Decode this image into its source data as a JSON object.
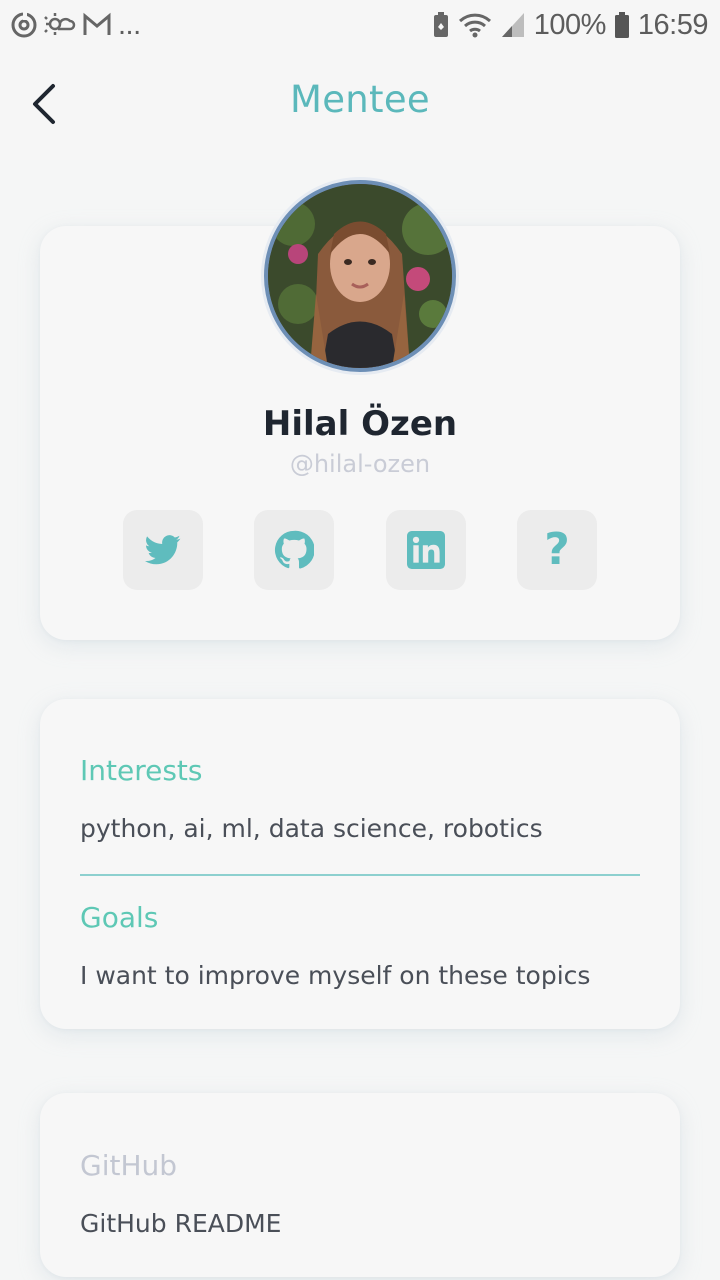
{
  "status_bar": {
    "battery": "100%",
    "time": "16:59",
    "overflow": "..."
  },
  "header": {
    "title": "Mentee"
  },
  "profile": {
    "name": "Hilal Özen",
    "handle": "@hilal-ozen",
    "social": [
      "twitter-icon",
      "github-icon",
      "linkedin-icon",
      "question-icon"
    ],
    "question_glyph": "?"
  },
  "about": {
    "interests_label": "Interests",
    "interests_value": "python, ai, ml, data science, robotics",
    "goals_label": "Goals",
    "goals_value": "I want to improve myself on these topics"
  },
  "github": {
    "label": "GitHub",
    "value": "GitHub README"
  },
  "colors": {
    "accent": "#5bb8bb",
    "section_label": "#5ec8b5",
    "muted": "#c3c7d2"
  }
}
